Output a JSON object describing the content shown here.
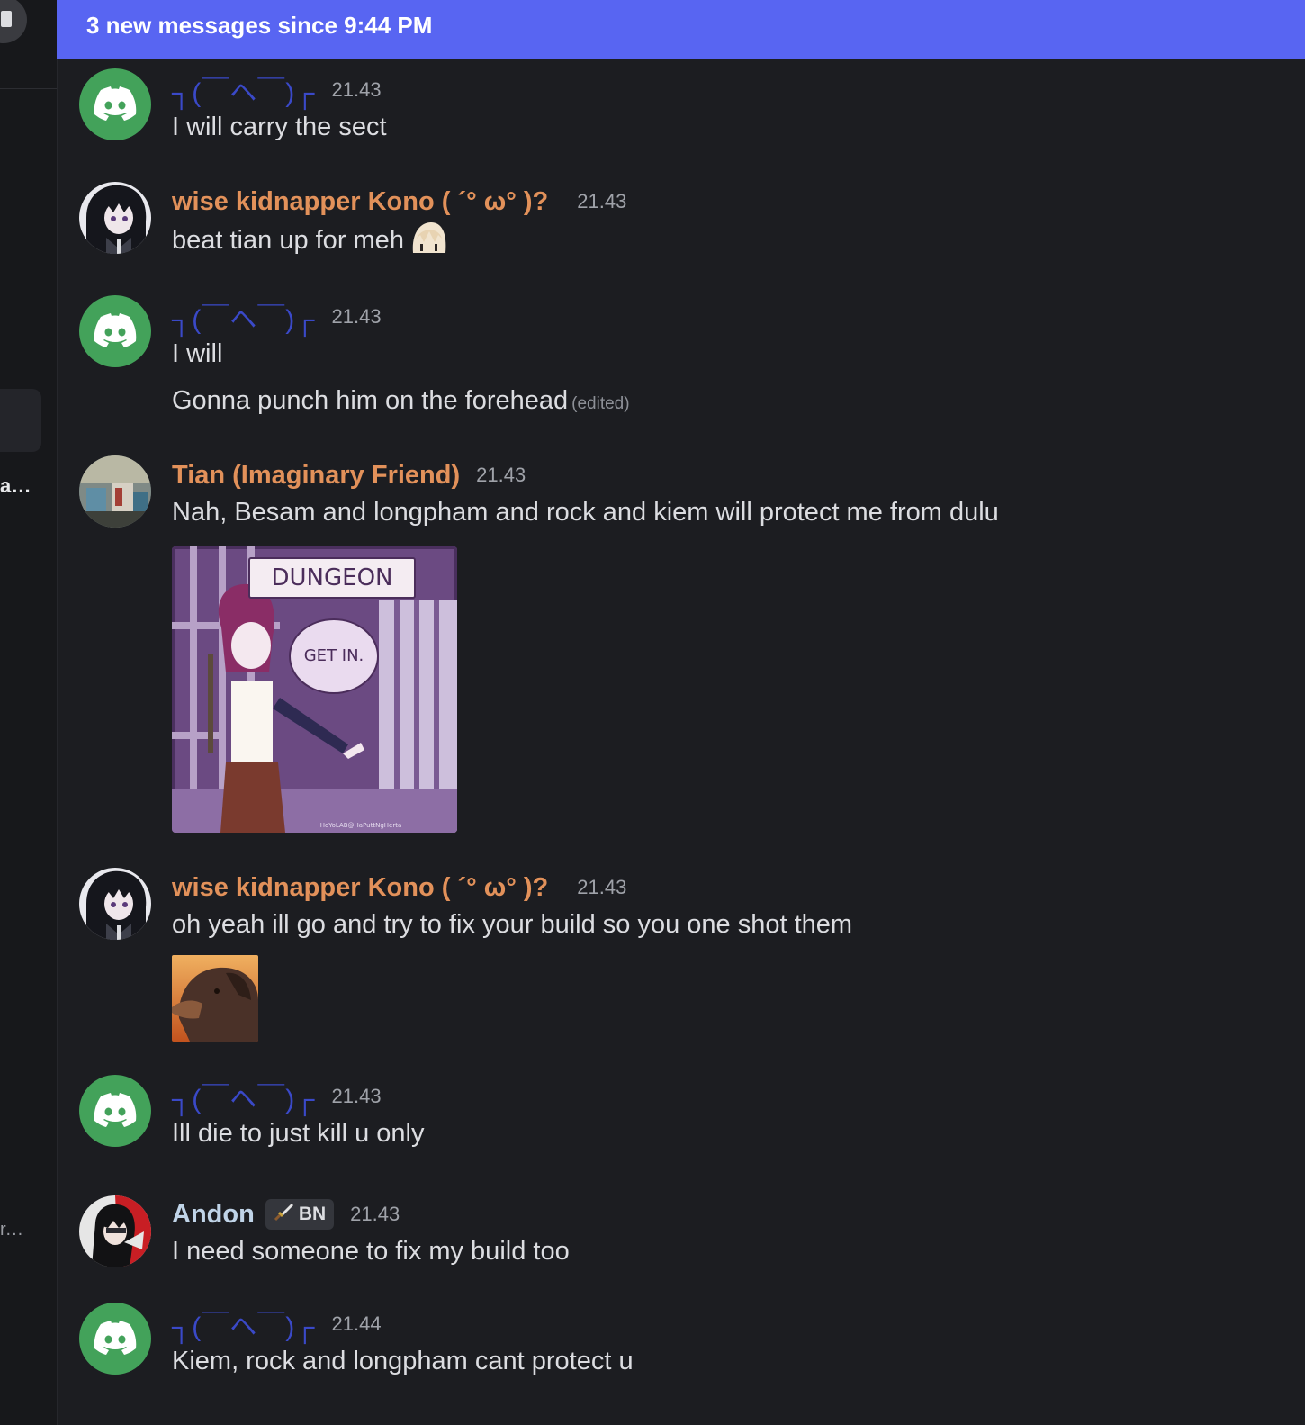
{
  "banner": {
    "text": "3 new messages since 9:44 PM"
  },
  "sidebar": {
    "trunc_1": "a...",
    "trunc_2": "r..."
  },
  "messages": [
    {
      "author": "┐(￣ヘ￣)┌",
      "time": "21.43",
      "lines": [
        "I will carry the sect"
      ]
    },
    {
      "author": "wise kidnapper Kono ( ´° ω° )?",
      "time": "21.43",
      "lines": [
        "beat tian up for meh"
      ]
    },
    {
      "author": "┐(￣ヘ￣)┌",
      "time": "21.43",
      "lines": [
        "I will",
        "Gonna punch him on the forehead"
      ],
      "edited_label": "(edited)"
    },
    {
      "author": "Tian (Imaginary Friend)",
      "time": "21.43",
      "lines": [
        "Nah, Besam and longpham and rock and kiem will protect me from dulu"
      ],
      "image": {
        "sign_text": "DUNGEON",
        "bubble_text": "GET IN.",
        "watermark": "HoYoLAB@HaPuttNgHerta"
      }
    },
    {
      "author": "wise kidnapper Kono ( ´° ω° )?",
      "time": "21.43",
      "lines": [
        "oh yeah ill go and try to fix your build so you one shot them"
      ]
    },
    {
      "author": "┐(￣ヘ￣)┌",
      "time": "21.43",
      "lines": [
        "Ill die to just kill u only"
      ]
    },
    {
      "author": "Andon",
      "badge": "BN",
      "time": "21.43",
      "lines": [
        "I need someone to fix my build too"
      ]
    },
    {
      "author": "┐(￣ヘ￣)┌",
      "time": "21.44",
      "lines": [
        "Kiem, rock and longpham cant protect u"
      ]
    }
  ],
  "colors": {
    "background": "#1c1d21",
    "banner": "#5865f2",
    "username_orange": "#e2915a",
    "username_blue": "#3a49c8",
    "username_andon": "#c0d4e8",
    "discord_green": "#43a25a"
  }
}
